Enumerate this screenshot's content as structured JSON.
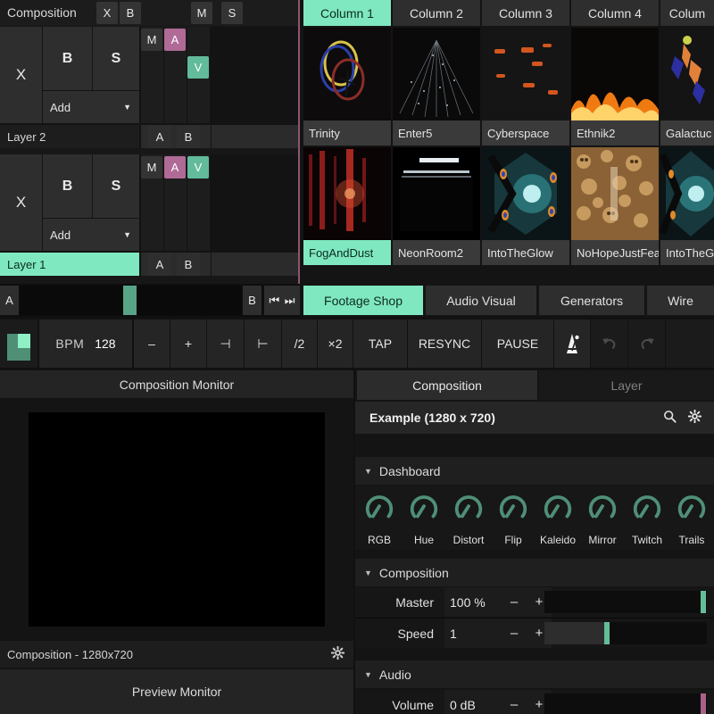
{
  "composition_header": {
    "title": "Composition",
    "buttons": [
      "X",
      "B",
      "M",
      "S"
    ]
  },
  "layers": [
    {
      "name": "Layer 2",
      "selected": false,
      "bypass_label": "X",
      "blend_b": "B",
      "solo_s": "S",
      "blend_mode": "Add",
      "toggles": {
        "m": "M",
        "a": "A",
        "v": "V"
      },
      "crossfader_a": "A",
      "crossfader_b": "B"
    },
    {
      "name": "Layer 1",
      "selected": true,
      "bypass_label": "X",
      "blend_b": "B",
      "solo_s": "S",
      "blend_mode": "Add",
      "toggles": {
        "m": "M",
        "a": "A",
        "v": "V"
      },
      "crossfader_a": "A",
      "crossfader_b": "B"
    }
  ],
  "crossfader": {
    "a_label": "A",
    "b_label": "B",
    "prev_icon": "skip-previous-icon",
    "next_icon": "skip-next-icon"
  },
  "columns": [
    {
      "label": "Column 1",
      "selected": true
    },
    {
      "label": "Column 2",
      "selected": false
    },
    {
      "label": "Column 3",
      "selected": false
    },
    {
      "label": "Column 4",
      "selected": false
    },
    {
      "label": "Colum",
      "selected": false
    }
  ],
  "clip_rows": [
    {
      "clips": [
        {
          "name": "Trinity",
          "selected": false,
          "art": "rings"
        },
        {
          "name": "Enter5",
          "selected": false,
          "art": "tunnel"
        },
        {
          "name": "Cyberspace",
          "selected": false,
          "art": "embers"
        },
        {
          "name": "Ethnik2",
          "selected": false,
          "art": "fire"
        },
        {
          "name": "Galactuc",
          "selected": false,
          "art": "dancer"
        }
      ]
    },
    {
      "clips": [
        {
          "name": "FogAndDust",
          "selected": true,
          "art": "redfog"
        },
        {
          "name": "NeonRoom2",
          "selected": false,
          "art": "neon"
        },
        {
          "name": "IntoTheGlow",
          "selected": false,
          "art": "glow"
        },
        {
          "name": "NoHopeJustFear",
          "selected": false,
          "art": "skulls"
        },
        {
          "name": "IntoTheG",
          "selected": false,
          "art": "glow"
        }
      ]
    }
  ],
  "deck_tabs": [
    {
      "label": "Footage Shop",
      "selected": true
    },
    {
      "label": "Audio Visual",
      "selected": false
    },
    {
      "label": "Generators",
      "selected": false
    },
    {
      "label": "Wire",
      "selected": false
    }
  ],
  "transport": {
    "bpm_label": "BPM",
    "bpm_value": "128",
    "minus": "–",
    "plus": "+",
    "nudge_left": "⊣",
    "nudge_right": "⊢",
    "half": "/2",
    "double": "×2",
    "tap": "TAP",
    "resync": "RESYNC",
    "pause": "PAUSE",
    "metronome_icon": "metronome-icon",
    "undo_icon": "undo-icon",
    "redo_icon": "redo-icon"
  },
  "monitors": {
    "composition_monitor_title": "Composition Monitor",
    "composition_footer": "Composition - 1280x720",
    "gear_icon": "gear-icon",
    "preview_monitor_title": "Preview Monitor"
  },
  "inspector": {
    "tabs": [
      {
        "label": "Composition",
        "selected": true
      },
      {
        "label": "Layer",
        "selected": false
      }
    ],
    "title": "Example (1280 x 720)",
    "search_icon": "search-icon",
    "gear_icon": "gear-icon",
    "sections": [
      {
        "label": "Dashboard",
        "expanded": true
      },
      {
        "label": "Composition",
        "expanded": true
      },
      {
        "label": "Audio",
        "expanded": true
      }
    ],
    "dashboard_knobs": [
      {
        "label": "RGB"
      },
      {
        "label": "Hue"
      },
      {
        "label": "Distort"
      },
      {
        "label": "Flip"
      },
      {
        "label": "Kaleido"
      },
      {
        "label": "Mirror"
      },
      {
        "label": "Twitch"
      },
      {
        "label": "Trails"
      }
    ],
    "params": [
      {
        "name": "Master",
        "value": "100 %",
        "minus": "–",
        "plus": "+",
        "fill_pct": 0,
        "handle_pct": 96,
        "handle_color": "green"
      },
      {
        "name": "Speed",
        "value": "1",
        "minus": "–",
        "plus": "+",
        "fill_pct": 37,
        "handle_pct": 37,
        "handle_color": "green"
      },
      {
        "name": "Volume",
        "value": "0 dB",
        "minus": "–",
        "plus": "+",
        "fill_pct": 0,
        "handle_pct": 96,
        "handle_color": "pink"
      }
    ]
  },
  "colors": {
    "accent_green": "#7fe8c0",
    "accent_pink": "#b06a96",
    "panel_dark": "#141414",
    "button_gray": "#2e2e2e"
  }
}
